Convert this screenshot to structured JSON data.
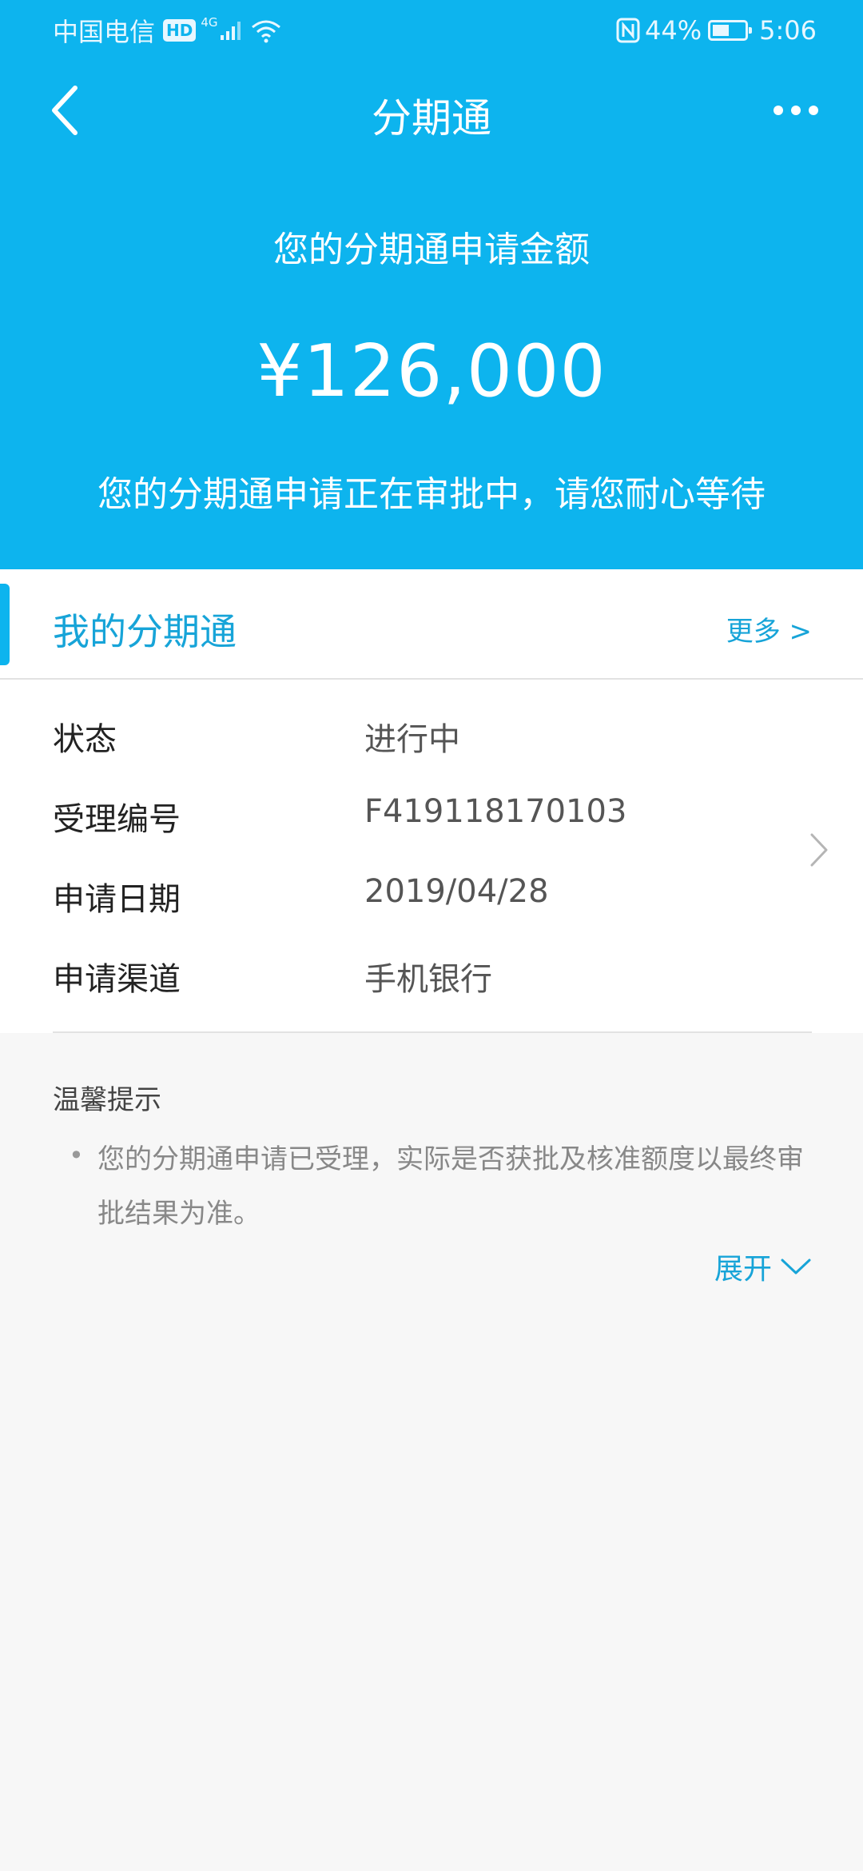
{
  "status_bar": {
    "carrier": "中国电信",
    "hd": "HD",
    "network": "4G",
    "battery": "44%",
    "time": "5:06"
  },
  "nav": {
    "title": "分期通"
  },
  "hero": {
    "label": "您的分期通申请金额",
    "amount": "¥126,000",
    "description": "您的分期通申请正在审批中，请您耐心等待"
  },
  "section": {
    "title": "我的分期通",
    "more": "更多 >"
  },
  "details": [
    {
      "label": "状态",
      "value": "进行中"
    },
    {
      "label": "受理编号",
      "value": "F419118170103"
    },
    {
      "label": "申请日期",
      "value": "2019/04/28"
    },
    {
      "label": "申请渠道",
      "value": "手机银行"
    }
  ],
  "tips": {
    "title": "温馨提示",
    "bullet": "•",
    "text": "您的分期通申请已受理，实际是否获批及核准额度以最终审批结果为准。",
    "expand": "展开"
  },
  "colors": {
    "primary": "#0db4ee",
    "link": "#17a4d8",
    "background": "#f7f7f7"
  }
}
